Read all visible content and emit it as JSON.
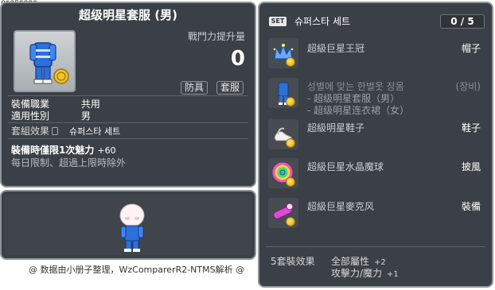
{
  "item_id": "01050296",
  "item": {
    "title": "超级明星套服 (男)",
    "power_label": "戰鬥力提升量",
    "power_value": "0",
    "tags": [
      "防具",
      "套服"
    ],
    "job_label": "裝備職業",
    "job_value": "共用",
    "gender_label": "適用性別",
    "gender_value": "男",
    "set_effect_label": "套組效果",
    "set_name": "슈퍼스타 세트",
    "bonus_text": "裝備時僅限1次魅力",
    "bonus_value": "+60",
    "note": "每日限制、超過上限時除外"
  },
  "credit": "@ 数据由小册子整理，WzComparerR2-NTMS解析 @",
  "set_panel": {
    "badge": "SET",
    "title": "슈퍼스타 세트",
    "count": "0 / 5",
    "items": [
      {
        "name": "超級巨星王冠",
        "slot": "帽子",
        "icon": "crown-icon"
      },
      {
        "name": "성별에 맞는 한벌옷 장몸",
        "slot": "(장비)",
        "icon": "overall-icon",
        "sub": [
          "- 超级明星套服（男）",
          "- 超级明星连衣裙（女）"
        ]
      },
      {
        "name": "超級明星鞋子",
        "slot": "鞋子",
        "icon": "shoes-icon"
      },
      {
        "name": "超級巨星水晶魔球",
        "slot": "披風",
        "icon": "crystal-orb-icon"
      },
      {
        "name": "超級巨星麥克风",
        "slot": "裝備",
        "icon": "microphone-icon"
      }
    ],
    "summary_label": "5套裝效果",
    "summary": [
      {
        "text": "全部屬性",
        "value": "+2"
      },
      {
        "text": "攻擊力/魔力",
        "value": "+1"
      }
    ]
  }
}
